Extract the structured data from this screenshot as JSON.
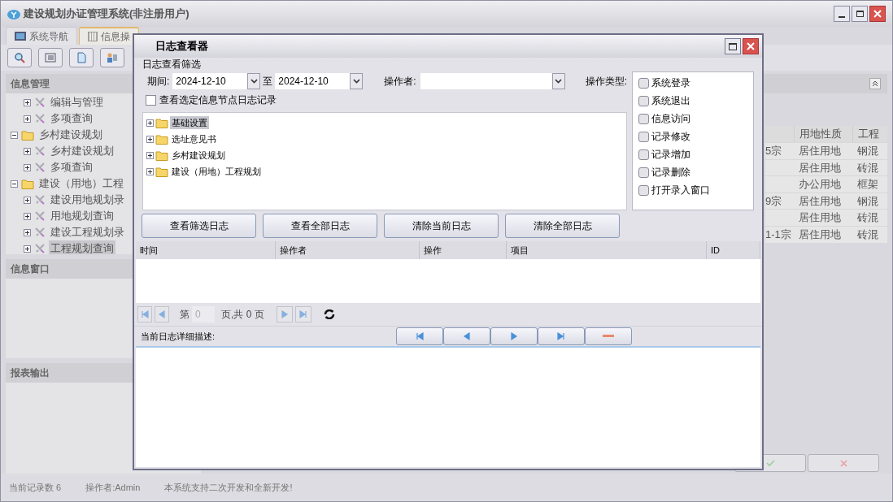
{
  "window": {
    "title": "建设规划办证管理系统(非注册用户)"
  },
  "tabs": [
    {
      "label": "系统导航",
      "selected": false
    },
    {
      "label": "信息操",
      "selected": true
    }
  ],
  "sidebar": {
    "sections": [
      {
        "title": "信息管理",
        "tree": [
          {
            "kind": "continued",
            "children": [
              {
                "kind": "tool",
                "label": "编辑与管理",
                "expanded": false,
                "selected": false
              },
              {
                "kind": "tool",
                "label": "多项查询",
                "expanded": false,
                "selected": false
              }
            ]
          },
          {
            "kind": "folder",
            "label": "乡村建设规划",
            "expanded": true,
            "selected": false,
            "children": [
              {
                "kind": "tool",
                "label": "乡村建设规划",
                "expanded": false,
                "selected": false
              },
              {
                "kind": "tool",
                "label": "多项查询",
                "expanded": false,
                "selected": false
              }
            ]
          },
          {
            "kind": "folder",
            "label": "建设（用地）工程",
            "expanded": true,
            "selected": false,
            "children": [
              {
                "kind": "tool",
                "label": "建设用地规划录",
                "expanded": false,
                "selected": false
              },
              {
                "kind": "tool",
                "label": "用地规划查询",
                "expanded": false,
                "selected": false
              },
              {
                "kind": "tool",
                "label": "建设工程规划录",
                "expanded": false,
                "selected": false
              },
              {
                "kind": "tool",
                "label": "工程规划查询",
                "expanded": false,
                "selected": true
              }
            ]
          }
        ]
      },
      {
        "title": "信息窗口"
      },
      {
        "title": "报表输出"
      }
    ]
  },
  "table": {
    "columns": [
      "用地性质",
      "工程"
    ],
    "rows": [
      {
        "column_1": "5宗",
        "land_use": "居住用地",
        "structure": "钢混"
      },
      {
        "land_use": "居住用地",
        "structure": "砖混"
      },
      {
        "land_use": "办公用地",
        "structure": "框架"
      },
      {
        "column_1": "9宗",
        "land_use": "居住用地",
        "structure": "钢混"
      },
      {
        "land_use": "居住用地",
        "structure": "砖混"
      },
      {
        "column_1": "1-1宗",
        "land_use": "居住用地",
        "structure": "砖混"
      }
    ]
  },
  "dialog": {
    "title": "日志查看器",
    "filter_title": "日志查看筛选",
    "period_label": "期间:",
    "date_from": "2024-12-10",
    "to_label": "至",
    "date_to": "2024-12-10",
    "operator_label": "操作者:",
    "operation_type_label": "操作类型:",
    "node_filter": {
      "label": "查看选定信息节点日志记录",
      "checked": false
    },
    "nodes": [
      {
        "label": "基础设置",
        "selected": true
      },
      {
        "label": "选址意见书",
        "selected": false
      },
      {
        "label": "乡村建设规划",
        "selected": false
      },
      {
        "label": "建设（用地）工程规划",
        "selected": false
      }
    ],
    "operation_types": [
      {
        "label": "系统登录",
        "checked": false
      },
      {
        "label": "系统退出",
        "checked": false
      },
      {
        "label": "信息访问",
        "checked": false
      },
      {
        "label": "记录修改",
        "checked": false
      },
      {
        "label": "记录增加",
        "checked": false
      },
      {
        "label": "记录删除",
        "checked": false
      },
      {
        "label": "打开录入窗口",
        "checked": false
      }
    ],
    "buttons": [
      "查看筛选日志",
      "查看全部日志",
      "清除当前日志",
      "清除全部日志"
    ],
    "log_columns": [
      "时间",
      "操作者",
      "操作",
      "项目",
      "ID"
    ],
    "pager": {
      "page_prefix": "第",
      "page": "0",
      "page_suffix": "页,共 0 页"
    },
    "detail_label": "当前日志详细描述:"
  },
  "status_bar": [
    "当前记录数 6",
    "操作者:Admin",
    "本系统支持二次开发和全新开发!"
  ]
}
